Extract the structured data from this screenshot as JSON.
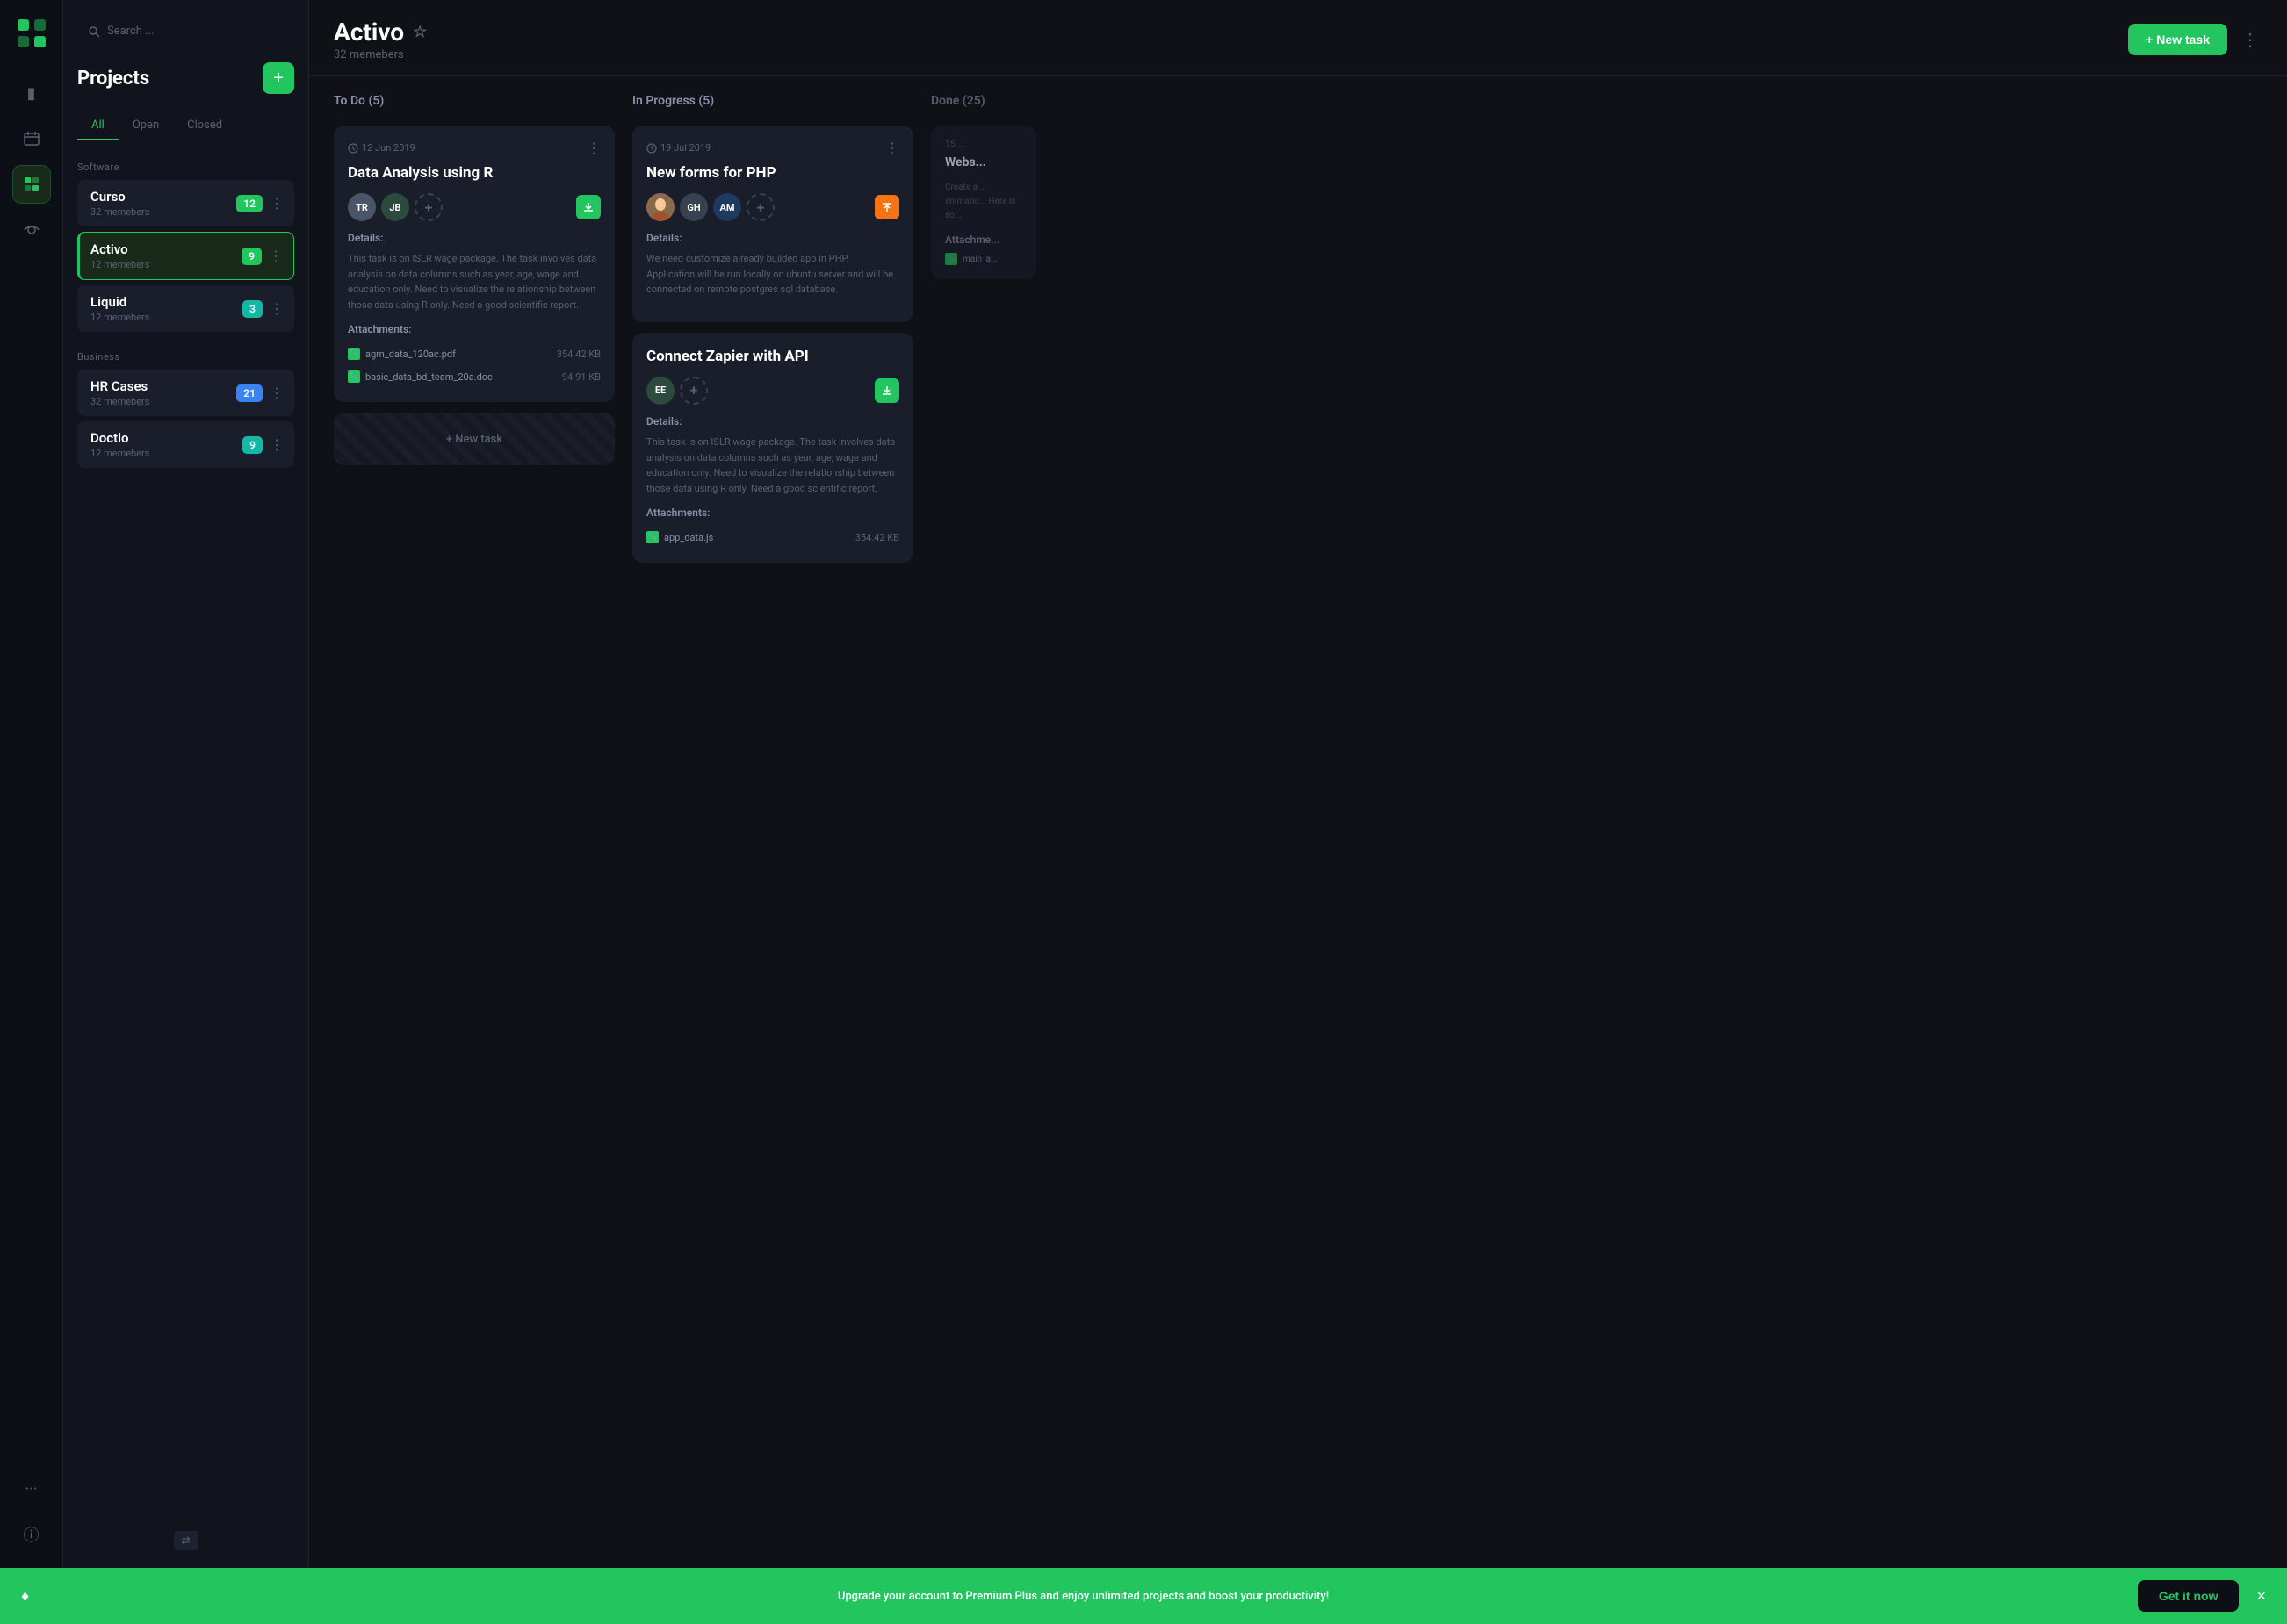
{
  "logo": {
    "alt": "App Logo"
  },
  "nav_icons": [
    {
      "name": "folder-icon",
      "symbol": "▣",
      "active": false
    },
    {
      "name": "calendar-icon",
      "symbol": "▦",
      "active": false
    },
    {
      "name": "counter-icon",
      "symbol": "⊞",
      "active": true
    },
    {
      "name": "eye-icon",
      "symbol": "◉",
      "active": false
    },
    {
      "name": "more-icon",
      "symbol": "···",
      "active": false
    },
    {
      "name": "info-icon",
      "symbol": "ⓘ",
      "active": false
    }
  ],
  "sidebar": {
    "search_placeholder": "Search ...",
    "title": "Projects",
    "add_button_label": "+",
    "filters": [
      "All",
      "Open",
      "Closed"
    ],
    "active_filter": "All",
    "sections": [
      {
        "label": "Software",
        "projects": [
          {
            "name": "Curso",
            "members": "32 memebers",
            "badge": 12,
            "badge_color": "green",
            "active": false
          },
          {
            "name": "Activo",
            "members": "12 memebers",
            "badge": 9,
            "badge_color": "green",
            "active": true
          },
          {
            "name": "Liquid",
            "members": "12 memebers",
            "badge": 3,
            "badge_color": "teal",
            "active": false
          }
        ]
      },
      {
        "label": "Business",
        "projects": [
          {
            "name": "HR Cases",
            "members": "32 memebers",
            "badge": 21,
            "badge_color": "blue",
            "active": false
          },
          {
            "name": "Doctio",
            "members": "12 memebers",
            "badge": 9,
            "badge_color": "teal",
            "active": false
          }
        ]
      }
    ]
  },
  "main": {
    "project_name": "Activo",
    "project_members": "32 memebers",
    "new_task_label": "+ New task",
    "columns": [
      {
        "title": "To Do (5)",
        "cards": [
          {
            "date": "12 Jun 2019",
            "title": "Data Analysis using R",
            "avatars": [
              "TR",
              "JB"
            ],
            "show_add_avatar": true,
            "download_color": "green",
            "details_label": "Details:",
            "description": "This task is on ISLR wage package. The task involves data analysis on data columns such as year, age, wage and education only. Need to visualize the relationship between those data using R only. Need a good scientific report.",
            "attachments_label": "Attachments:",
            "attachments": [
              {
                "name": "agm_data_120ac.pdf",
                "size": "354.42 KB"
              },
              {
                "name": "basic_data_bd_team_20a.doc",
                "size": "94.91 KB"
              }
            ]
          }
        ],
        "new_task_label": "+ New task"
      },
      {
        "title": "In Progress (5)",
        "cards": [
          {
            "date": "19 Jul 2019",
            "title": "New forms for PHP",
            "avatars_img": true,
            "avatars": [
              "GH",
              "AM"
            ],
            "show_add_avatar": true,
            "download_color": "orange",
            "details_label": "Details:",
            "description": "We need customize already builded app in PHP. Application will be run locally on ubuntu server and will be connected on remote postgres sql database.",
            "attachments": []
          },
          {
            "date": "",
            "title": "Connect Zapier with API",
            "avatars": [
              "EE"
            ],
            "show_add_avatar": true,
            "download_color": "green",
            "details_label": "Details:",
            "description": "This task is on ISLR wage package. The task involves data analysis on data columns such as year, age, wage and education only. Need to visualize the relationship between those data using R only. Need a good scientific report.",
            "attachments_label": "Attachments:",
            "attachments": [
              {
                "name": "app_data.js",
                "size": "354.42 KB"
              }
            ]
          }
        ]
      },
      {
        "title": "Done (25)",
        "partial": true,
        "cards": [
          {
            "date": "15 ...",
            "title": "Webs...",
            "description": "Create a ... animatio... Here is so...",
            "attachments_label": "Attachme...",
            "attachments": [
              {
                "name": "main_a...",
                "size": ""
              }
            ]
          }
        ]
      }
    ]
  },
  "banner": {
    "icon": "♦",
    "text": "Upgrade your account to Premium Plus and enjoy unlimited projects and boost your productivity!",
    "cta_label": "Get it now",
    "close_label": "×"
  }
}
